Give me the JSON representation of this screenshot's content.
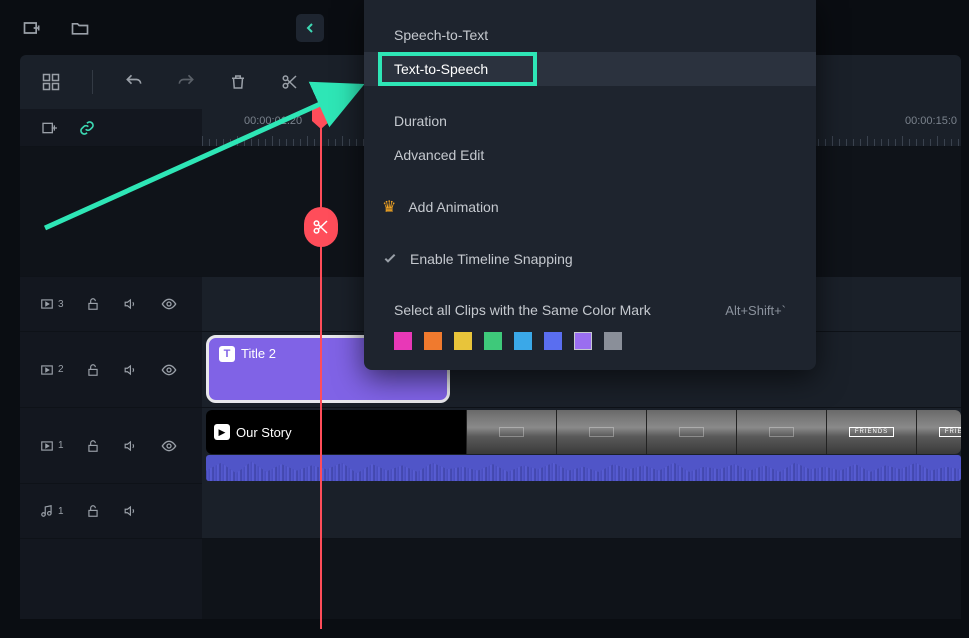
{
  "topbar": {
    "icons": [
      "new-folder-icon",
      "folder-icon"
    ]
  },
  "toolbar": {
    "icons": [
      "grid-icon",
      "undo-icon",
      "redo-icon",
      "trash-icon",
      "scissors-icon"
    ]
  },
  "ruler": {
    "left_time": "00:00:01:20",
    "right_time": "00:00:15:0"
  },
  "tracks": [
    {
      "type": "video",
      "index": 3
    },
    {
      "type": "video",
      "index": 2
    },
    {
      "type": "video",
      "index": 1
    },
    {
      "type": "audio",
      "index": 1
    }
  ],
  "clips": {
    "title": {
      "label": "Title 2"
    },
    "video": {
      "label": "Our Story",
      "thumb_labels": [
        "",
        "",
        "",
        "",
        "FRIENDS",
        "FRIENDS"
      ]
    }
  },
  "context_menu": {
    "items": [
      {
        "key": "speech_to_text",
        "label": "Speech-to-Text"
      },
      {
        "key": "text_to_speech",
        "label": "Text-to-Speech",
        "highlighted": true
      },
      {
        "key": "duration",
        "label": "Duration"
      },
      {
        "key": "advanced_edit",
        "label": "Advanced Edit"
      },
      {
        "key": "add_animation",
        "label": "Add Animation",
        "icon": "crown"
      },
      {
        "key": "timeline_snap",
        "label": "Enable Timeline Snapping",
        "icon": "check"
      }
    ],
    "color_section": {
      "label": "Select all Clips with the Same Color Mark",
      "shortcut": "Alt+Shift+`",
      "colors": [
        "#e838b7",
        "#f07a2e",
        "#e8c43a",
        "#3ec97a",
        "#3aa8e8",
        "#5a6ef0",
        "#9a6ef0",
        "#8a8f99"
      ]
    }
  }
}
